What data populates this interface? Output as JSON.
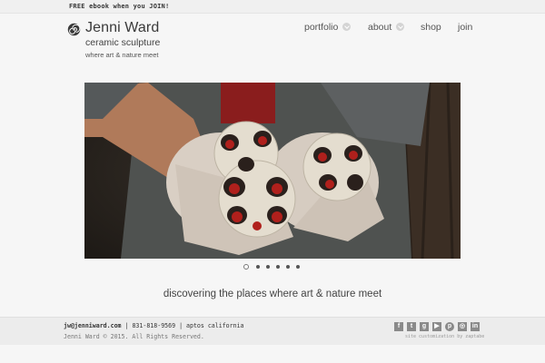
{
  "topbar": {
    "text": "FREE ebook when you JOIN!"
  },
  "brand": {
    "name": "Jenni Ward",
    "subtitle": "ceramic sculpture",
    "tagline": "where art & nature meet",
    "logo_icon": "spiral-icon"
  },
  "nav": {
    "portfolio": "portfolio",
    "about": "about",
    "shop": "shop",
    "join": "join"
  },
  "slider": {
    "total": 6,
    "active_index": 0
  },
  "tagline": "discovering the places where art & nature meet",
  "footer": {
    "email": "jw@jenniward.com",
    "sep1": " | ",
    "phone": "831-818-9569",
    "sep2": " | ",
    "location": "aptos california",
    "copyright": "Jenni Ward © 2015. All Rights Reserved.",
    "credit": "site customization by zaptabe",
    "social_icons": [
      "facebook-icon",
      "twitter-icon",
      "google-plus-icon",
      "youtube-icon",
      "pinterest-icon",
      "instagram-icon",
      "linkedin-icon"
    ]
  }
}
